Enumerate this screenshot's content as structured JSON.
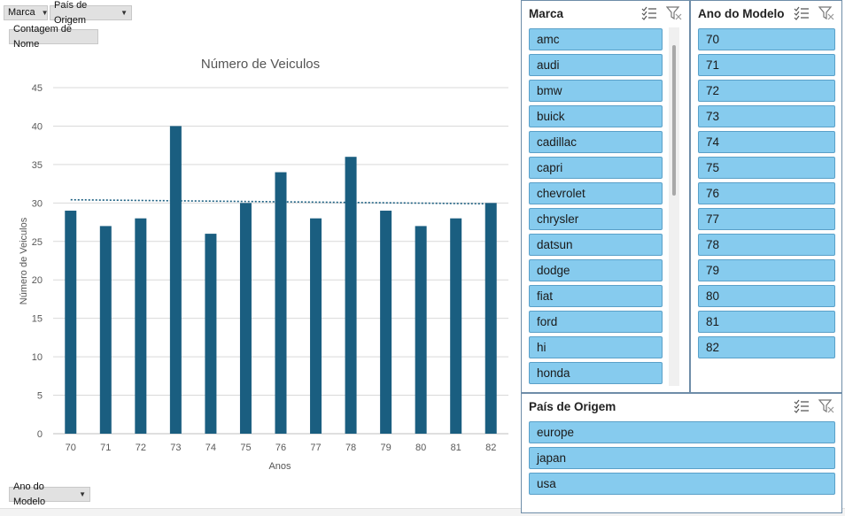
{
  "pivot_buttons": {
    "marca": "Marca",
    "pais": "País de Origem",
    "values": "Contagem de Nome",
    "axis": "Ano do Modelo"
  },
  "chart_data": {
    "type": "bar",
    "title": "Número de Veiculos",
    "xlabel": "Anos",
    "ylabel": "Número de Veiculos",
    "categories": [
      "70",
      "71",
      "72",
      "73",
      "74",
      "75",
      "76",
      "77",
      "78",
      "79",
      "80",
      "81",
      "82"
    ],
    "values": [
      29,
      27,
      28,
      40,
      26,
      30,
      34,
      28,
      36,
      29,
      27,
      28,
      30
    ],
    "ylim": [
      0,
      45
    ],
    "yticks": [
      "0",
      "5",
      "10",
      "15",
      "20",
      "25",
      "30",
      "35",
      "40",
      "45"
    ],
    "trendline": "linear",
    "bar_color": "#1a5e80",
    "trend_color": "#1a5e80",
    "grid": true
  },
  "slicers": {
    "marca": {
      "title": "Marca",
      "items": [
        "amc",
        "audi",
        "bmw",
        "buick",
        "cadillac",
        "capri",
        "chevrolet",
        "chrysler",
        "datsun",
        "dodge",
        "fiat",
        "ford",
        "hi",
        "honda"
      ]
    },
    "ano": {
      "title": "Ano do Modelo",
      "items": [
        "70",
        "71",
        "72",
        "73",
        "74",
        "75",
        "76",
        "77",
        "78",
        "79",
        "80",
        "81",
        "82"
      ]
    },
    "pais": {
      "title": "País de Origem",
      "items": [
        "europe",
        "japan",
        "usa"
      ]
    }
  },
  "colors": {
    "slicer_item_bg": "#86cbee",
    "slicer_border": "#6e8da8"
  }
}
